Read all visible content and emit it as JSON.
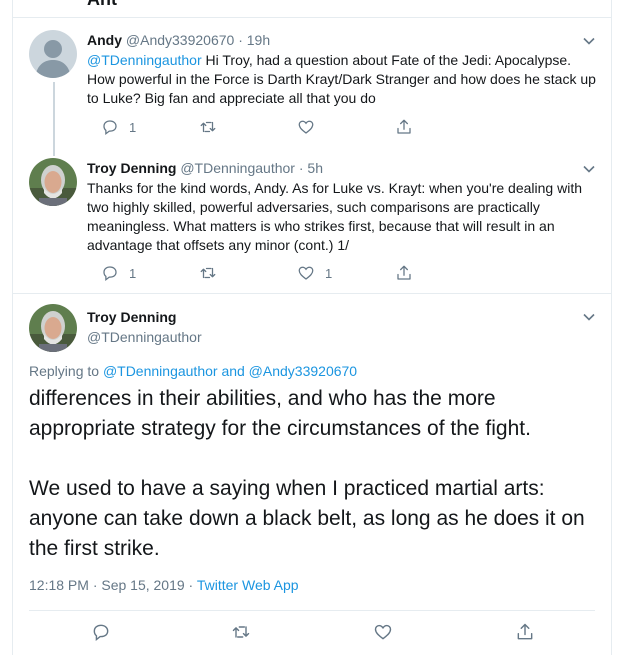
{
  "top_stub": {
    "text": "Ant"
  },
  "colors": {
    "link": "#1b95e0",
    "muted": "#657786",
    "border": "#e6ecf0"
  },
  "tweets": [
    {
      "name": "Andy",
      "handle": "@Andy33920670",
      "time": "· 19h",
      "mention": "@TDenningauthor",
      "text": " Hi Troy, had a question about Fate of the Jedi: Apocalypse. How powerful in the Force is Darth Krayt/Dark Stranger and how does he stack up to Luke? Big fan and appreciate all that you do",
      "reply_count": "1",
      "retweet_count": "",
      "like_count": ""
    },
    {
      "name": "Troy Denning",
      "handle": "@TDenningauthor",
      "time": "· 5h",
      "text": "Thanks for the kind words, Andy. As for Luke vs. Krayt: when you're dealing with two highly skilled, powerful adversaries, such comparisons are practically meaningless. What matters is who strikes first, because that will result in an advantage that offsets any minor (cont.) 1/",
      "reply_count": "1",
      "retweet_count": "",
      "like_count": "1"
    }
  ],
  "main_tweet": {
    "name": "Troy Denning",
    "handle": "@TDenningauthor",
    "replying_prefix": "Replying to ",
    "replying_to": "@TDenningauthor and @Andy33920670",
    "paragraph1": "differences in their abilities, and who has the more appropriate strategy for the circumstances of the fight.",
    "paragraph2": "We used to have a saying when I practiced martial arts: anyone can take down a black belt, as long as he does it on the first strike.",
    "timestamp": "12:18 PM · Sep 15, 2019 · ",
    "source": "Twitter Web App"
  }
}
